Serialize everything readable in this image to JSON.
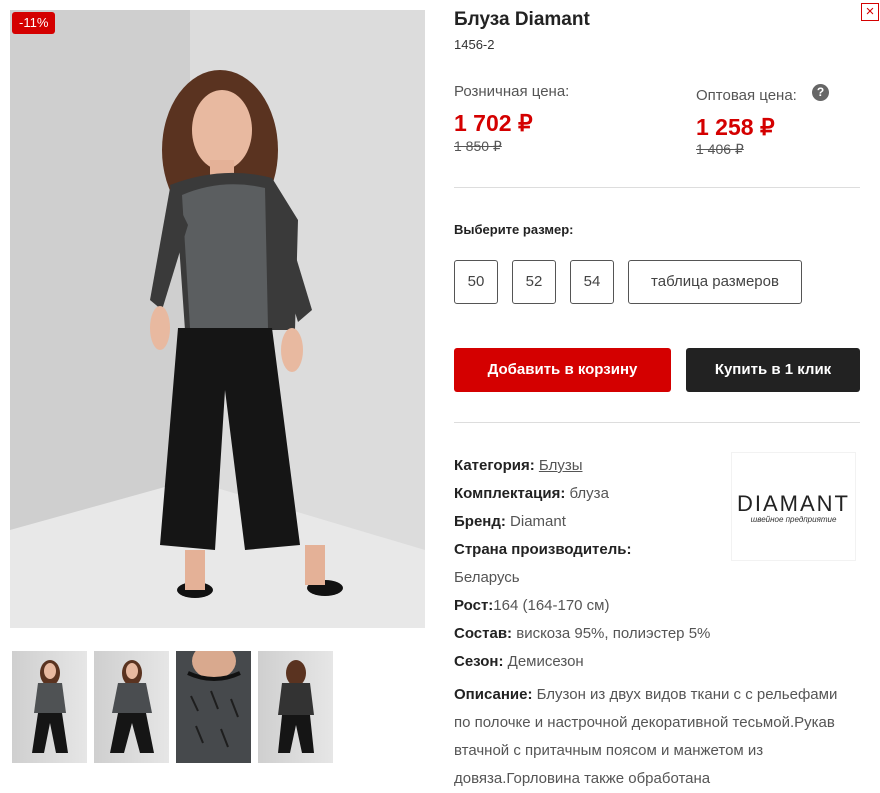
{
  "close": {
    "icon": "close-icon",
    "symbol": "×"
  },
  "gallery": {
    "badge": "-11%",
    "thumbnails_count": 4
  },
  "product": {
    "title": "Блуза Diamant",
    "sku": "1456-2",
    "retail_label": "Розничная цена:",
    "retail_price": "1 702 ₽",
    "retail_old": "1 850 ₽",
    "wholesale_label": "Оптовая цена:",
    "wholesale_price": "1 258 ₽",
    "wholesale_old": "1 406 ₽",
    "help_symbol": "?"
  },
  "sizes": {
    "label": "Выберите размер:",
    "options": [
      "50",
      "52",
      "54"
    ],
    "table_label": "таблица размеров"
  },
  "actions": {
    "add_to_cart": "Добавить в корзину",
    "buy_one_click": "Купить в 1 клик"
  },
  "specs": {
    "category_label": "Категория:",
    "category_value": "Блузы",
    "set_label": "Комплектация:",
    "set_value": "блуза",
    "brand_label": "Бренд:",
    "brand_value": "Diamant",
    "country_label": "Страна производитель:",
    "country_value": "Беларусь",
    "height_label": "Рост:",
    "height_value": "164 (164-170 см)",
    "composition_label": "Состав:",
    "composition_value": "вискоза 95%, полиэстер 5%",
    "season_label": "Сезон:",
    "season_value": "Демисезон",
    "description_label": "Описание:",
    "description_value": "Блузон из двух видов ткани с с рельефами по полочке и настрочной декоративной тесьмой.Рукав втачной с притачным поясом и манжетом из довяза.Горловина также обработана"
  },
  "brand_logo": {
    "name": "DIAMANT",
    "tagline": "швейное предприятие"
  },
  "colors": {
    "accent": "#d40000",
    "dark": "#222222",
    "text": "#555555"
  }
}
